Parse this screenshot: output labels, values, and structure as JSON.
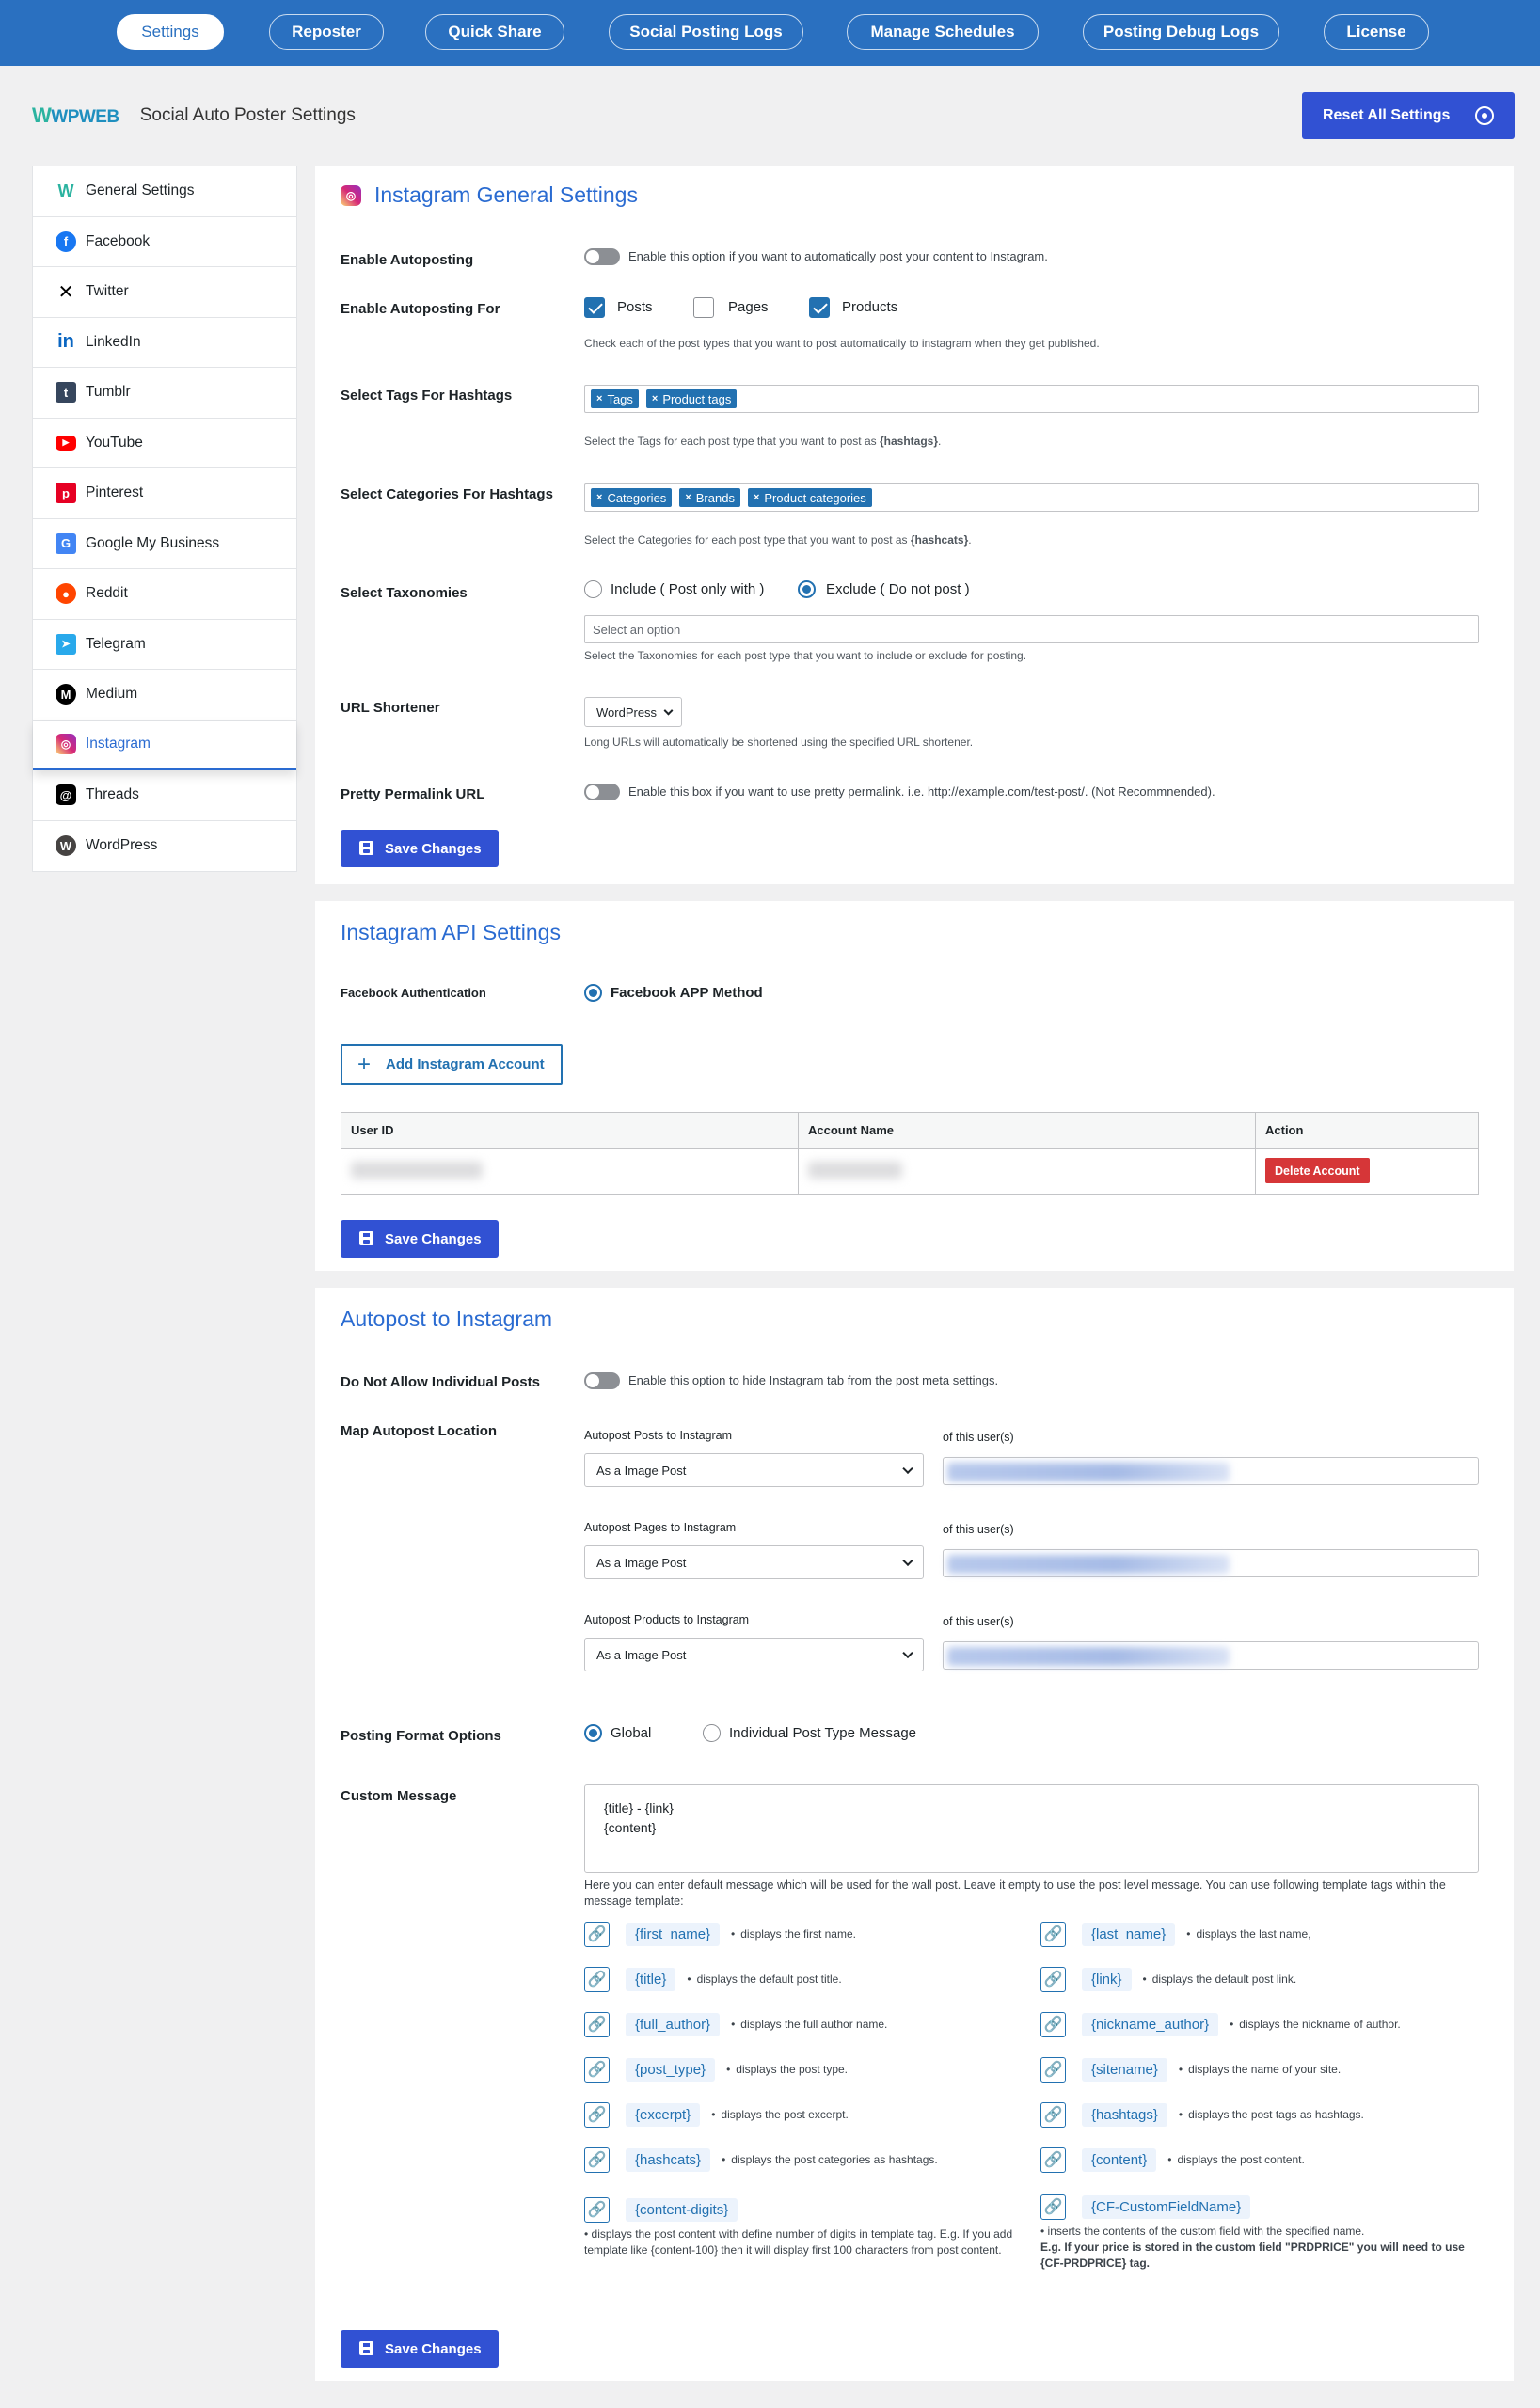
{
  "nav": {
    "tabs": [
      "Settings",
      "Reposter",
      "Quick Share",
      "Social Posting Logs",
      "Manage Schedules",
      "Posting Debug Logs",
      "License"
    ],
    "active": "Settings"
  },
  "header": {
    "logo": "WPWEB",
    "title": "Social Auto Poster Settings",
    "reset_label": "Reset All Settings"
  },
  "sidebar": {
    "items": [
      "General Settings",
      "Facebook",
      "Twitter",
      "LinkedIn",
      "Tumblr",
      "YouTube",
      "Pinterest",
      "Google My Business",
      "Reddit",
      "Telegram",
      "Medium",
      "Instagram",
      "Threads",
      "WordPress"
    ],
    "active": "Instagram"
  },
  "general": {
    "title": "Instagram General Settings",
    "enable_autoposting": {
      "label": "Enable Autoposting",
      "desc": "Enable this option if you want to automatically post your content to Instagram.",
      "on": false
    },
    "enable_for": {
      "label": "Enable Autoposting For",
      "options": [
        {
          "label": "Posts",
          "checked": true
        },
        {
          "label": "Pages",
          "checked": false
        },
        {
          "label": "Products",
          "checked": true
        }
      ],
      "desc": "Check each of the post types that you want to post automatically to instagram when they get published."
    },
    "tags_hashtags": {
      "label": "Select Tags For Hashtags",
      "tags": [
        "Tags",
        "Product tags"
      ],
      "desc_pre": "Select the Tags for each post type that you want to post as ",
      "desc_bold": "{hashtags}",
      "desc_post": "."
    },
    "cats_hashtags": {
      "label": "Select Categories For Hashtags",
      "tags": [
        "Categories",
        "Brands",
        "Product categories"
      ],
      "desc_pre": "Select the Categories for each post type that you want to post as ",
      "desc_bold": "{hashcats}",
      "desc_post": "."
    },
    "taxonomies": {
      "label": "Select Taxonomies",
      "include": "Include ( Post only with )",
      "exclude": "Exclude ( Do not post )",
      "selected": "exclude",
      "placeholder": "Select an option",
      "desc": "Select the Taxonomies for each post type that you want to include or exclude for posting."
    },
    "shortener": {
      "label": "URL Shortener",
      "value": "WordPress",
      "desc": "Long URLs will automatically be shortened using the specified URL shortener."
    },
    "pretty": {
      "label": "Pretty Permalink URL",
      "desc": "Enable this box if you want to use pretty permalink. i.e. http://example.com/test-post/. (Not Recommnended).",
      "on": false
    },
    "save_label": "Save Changes"
  },
  "api": {
    "title": "Instagram API Settings",
    "auth_label": "Facebook Authentication",
    "auth_method": "Facebook APP Method",
    "add_account": "Add Instagram Account",
    "columns": [
      "User ID",
      "Account Name",
      "Action"
    ],
    "delete_label": "Delete Account",
    "save_label": "Save Changes"
  },
  "autopost": {
    "title": "Autopost to Instagram",
    "no_individual": {
      "label": "Do Not Allow Individual Posts",
      "desc": "Enable this option to hide Instagram tab from the post meta settings.",
      "on": false
    },
    "map_label": "Map Autopost Location",
    "maps": [
      {
        "label": "Autopost Posts to Instagram",
        "value": "As a Image Post",
        "user_label": "of this user(s)"
      },
      {
        "label": "Autopost Pages to Instagram",
        "value": "As a Image Post",
        "user_label": "of this user(s)"
      },
      {
        "label": "Autopost Products to Instagram",
        "value": "As a Image Post",
        "user_label": "of this user(s)"
      }
    ],
    "format": {
      "label": "Posting Format Options",
      "global": "Global",
      "individual": "Individual Post Type Message",
      "selected": "global"
    },
    "custom_message": {
      "label": "Custom Message",
      "value": "{title} - {link}\n{content}",
      "help": "Here you can enter default message which will be used for the wall post. Leave it empty to use the post level message. You can use following template tags within the message template:"
    },
    "templates_left": [
      {
        "tag": "{first_name}",
        "desc": "displays the first name."
      },
      {
        "tag": "{title}",
        "desc": "displays the default post title."
      },
      {
        "tag": "{full_author}",
        "desc": "displays the full author name."
      },
      {
        "tag": "{post_type}",
        "desc": "displays the post type."
      },
      {
        "tag": "{excerpt}",
        "desc": "displays the post excerpt."
      },
      {
        "tag": "{hashcats}",
        "desc": "displays the post categories as hashtags."
      }
    ],
    "templates_right": [
      {
        "tag": "{last_name}",
        "desc": "displays the last name,"
      },
      {
        "tag": "{link}",
        "desc": "displays the default post link."
      },
      {
        "tag": "{nickname_author}",
        "desc": "displays the nickname of author."
      },
      {
        "tag": "{sitename}",
        "desc": "displays the name of your site."
      },
      {
        "tag": "{hashtags}",
        "desc": "displays the post tags as hashtags."
      },
      {
        "tag": "{content}",
        "desc": "displays the post content."
      }
    ],
    "digits": {
      "tag": "{content-digits}",
      "desc": "• displays the post content with define number of digits in template tag. E.g. If you add template like {content-100} then it will display first 100 characters from post content."
    },
    "cf": {
      "tag": "{CF-CustomFieldName}",
      "desc": "• inserts the contents of the custom field with the specified name.",
      "example": "E.g. If your price is stored in the custom field \"PRDPRICE\" you will need to use {CF-PRDPRICE} tag."
    },
    "save_label": "Save Changes"
  }
}
